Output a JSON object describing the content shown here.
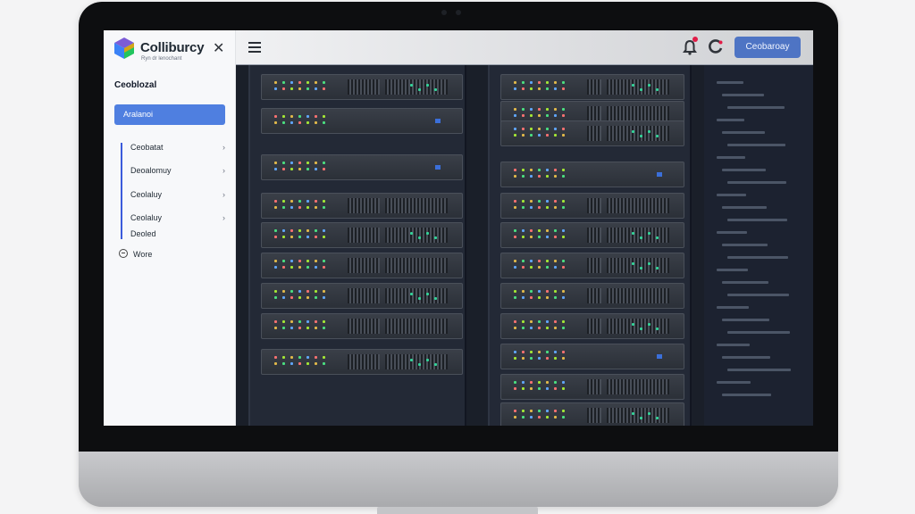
{
  "app": {
    "brand": "Colliburcy",
    "brand_subtitle": "Ryn dr lenochant"
  },
  "sidebar": {
    "section_title": "Ceoblozal",
    "primary_button": "Aralanoi",
    "items": [
      {
        "label": "Ceobatat"
      },
      {
        "label": "Deoalomuy"
      },
      {
        "label": "Ceolaluy"
      },
      {
        "label": "Ceolaluy"
      }
    ],
    "sub_label": "Deoled",
    "more_label": "Wore"
  },
  "topbar": {
    "action_button": "Ceobaroay"
  },
  "colors": {
    "accent": "#4f7fe0",
    "nav_accent": "#3b5bdb",
    "badge": "#e11d48",
    "rack_background": "#1a1f29"
  },
  "icons": [
    "logo-cube-icon",
    "close-icon",
    "menu-icon",
    "chevron-right-icon",
    "minus-circle-icon",
    "bell-icon",
    "refresh-icon"
  ]
}
